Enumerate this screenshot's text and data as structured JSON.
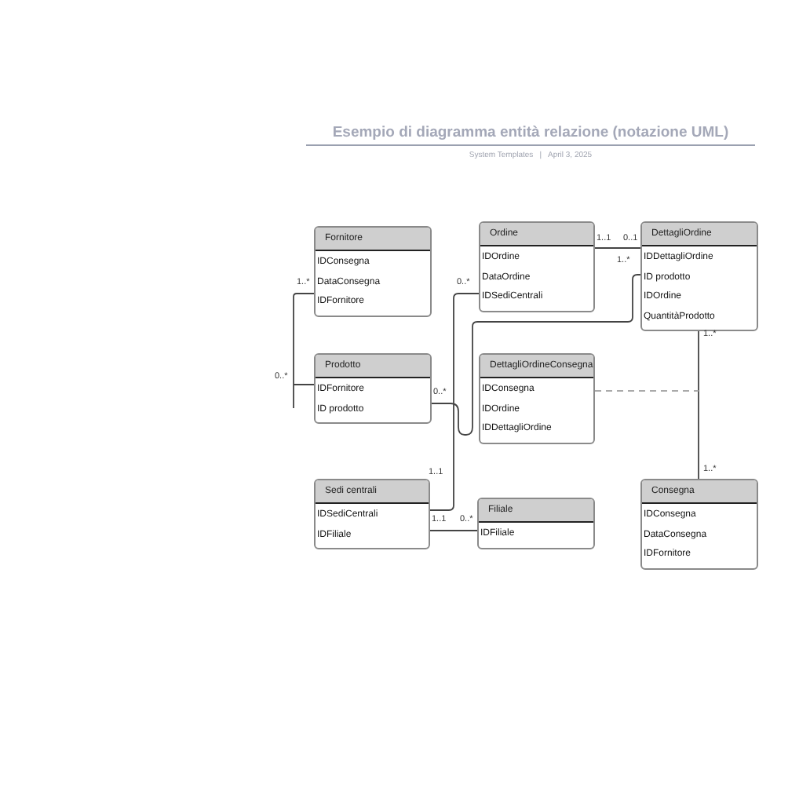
{
  "title": "Esempio di diagramma entità relazione (notazione UML)",
  "subtitle": {
    "source": "System Templates",
    "separator": "|",
    "date": "April 3, 2025"
  },
  "entities": [
    {
      "name": "Fornitore",
      "attributes": [
        "IDConsegna",
        "DataConsegna",
        "IDFornitore"
      ]
    },
    {
      "name": "Ordine",
      "attributes": [
        "IDOrdine",
        "DataOrdine",
        "IDSediCentrali"
      ]
    },
    {
      "name": "DettagliOrdine",
      "attributes": [
        "IDDettagliOrdine",
        "ID prodotto",
        "IDOrdine",
        "QuantitàProdotto"
      ]
    },
    {
      "name": "Prodotto",
      "attributes": [
        "IDFornitore",
        "ID prodotto"
      ]
    },
    {
      "name": "DettagliOrdineConsegna",
      "attributes": [
        "IDConsegna",
        "IDOrdine",
        "IDDettagliOrdine"
      ]
    },
    {
      "name": "Sedi centrali",
      "attributes": [
        "IDSediCentrali",
        "IDFiliale"
      ]
    },
    {
      "name": "Filiale",
      "attributes": [
        "IDFiliale"
      ]
    },
    {
      "name": "Consegna",
      "attributes": [
        "IDConsegna",
        "DataConsegna",
        "IDFornitore"
      ]
    }
  ],
  "relationships": [
    {
      "kind": "solid",
      "labels": [
        "1..*",
        "0..*"
      ]
    },
    {
      "kind": "solid",
      "labels": [
        "0..*",
        "1..1"
      ]
    },
    {
      "kind": "solid",
      "labels": [
        "1..1",
        "0..1"
      ]
    },
    {
      "kind": "solid",
      "labels": [
        "0..*",
        "1..*"
      ]
    },
    {
      "kind": "solid",
      "labels": [
        "1..*",
        "1..*"
      ]
    },
    {
      "kind": "dashed"
    },
    {
      "kind": "solid",
      "labels": [
        "1..1",
        "0..*"
      ]
    }
  ]
}
